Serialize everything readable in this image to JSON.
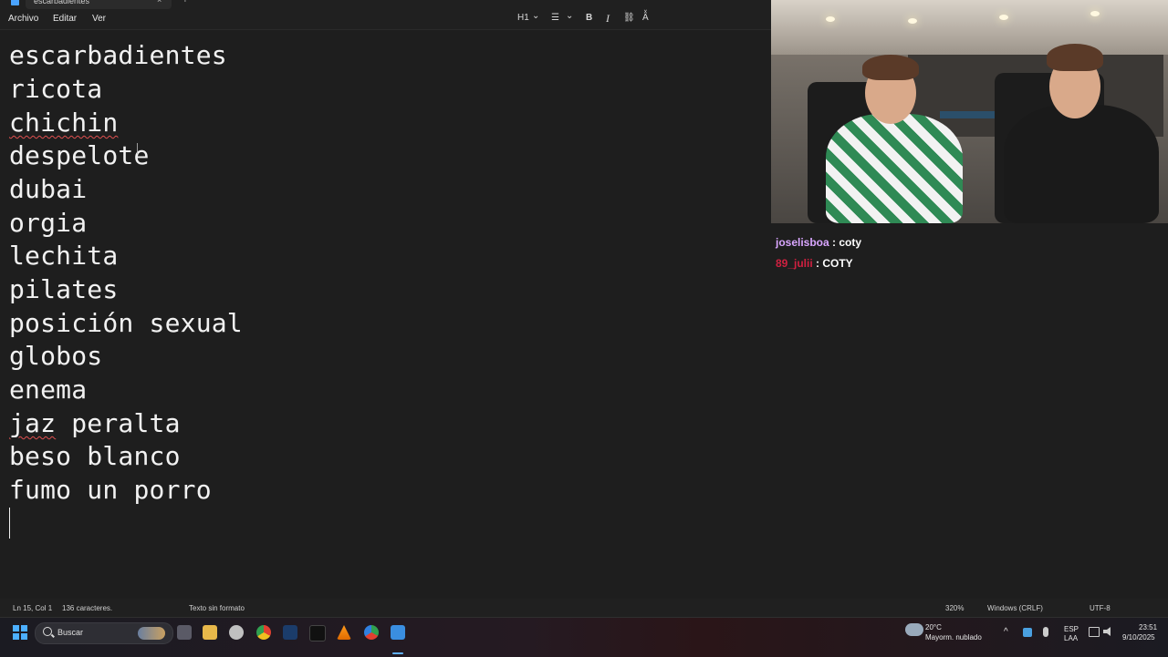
{
  "titlebar": {
    "tab_title": "escarbadientes",
    "close": "×",
    "new_tab": "+"
  },
  "menubar": {
    "file": "Archivo",
    "edit": "Editar",
    "view": "Ver",
    "heading": "H1",
    "heading_chevron": "⌄",
    "list_icon": "☰",
    "list_chevron": "⌄",
    "bold": "B",
    "italic": "I",
    "link_icon": "⛓",
    "clear_format_icon": "Aͯ"
  },
  "editor": {
    "lines": [
      "escarbadientes",
      "ricota",
      "chichin",
      "despelote",
      "dubai",
      "orgia",
      "lechita",
      "pilates",
      "posición sexual",
      "globos",
      "enema",
      "jaz peralta",
      "beso blanco",
      "fumo un porro"
    ]
  },
  "statusbar": {
    "position": "Ln 15, Col 1",
    "chars": "136 caracteres.",
    "format": "Texto sin formato",
    "zoom": "320%",
    "line_endings": "Windows (CRLF)",
    "encoding": "UTF-8"
  },
  "chat": {
    "messages": [
      {
        "user": "joselisboa",
        "text": " : coty"
      },
      {
        "user": "89_julii",
        "text": " : COTY"
      }
    ]
  },
  "taskbar": {
    "search": "Buscar",
    "weather_temp": "20°C",
    "weather_desc": "Mayorm. nublado",
    "lang_1": "ESP",
    "lang_2": "LAA",
    "time": "23:51",
    "date": "9/10/2025"
  },
  "colors": {
    "accent": "#4cb0ff",
    "spell_error": "#e05050",
    "chat_user1": "#d9a6ff",
    "chat_user2": "#d02040"
  }
}
